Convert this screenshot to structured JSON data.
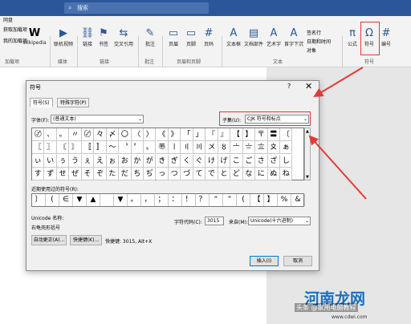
{
  "titlebar": {
    "search_placeholder": "搜索",
    "search_icon": "search-icon",
    "left_text": "网盘"
  },
  "ribbon": {
    "items": [
      {
        "label": "Wikipedia",
        "glyph": "W"
      },
      {
        "label": "联机视频",
        "glyph": "▶"
      },
      {
        "label": "链接",
        "glyph": "⛓"
      },
      {
        "label": "书签",
        "glyph": "⚑"
      },
      {
        "label": "交叉引用",
        "glyph": "⇆"
      },
      {
        "label": "批注",
        "glyph": "✎"
      },
      {
        "label": "页眉",
        "glyph": "▭"
      },
      {
        "label": "页脚",
        "glyph": "▭"
      },
      {
        "label": "页码",
        "glyph": "#"
      },
      {
        "label": "文本框",
        "glyph": "A"
      },
      {
        "label": "文档部件",
        "glyph": "▤"
      },
      {
        "label": "艺术字",
        "glyph": "A"
      },
      {
        "label": "首字下沉",
        "glyph": "A"
      },
      {
        "label": "公式",
        "glyph": "π"
      },
      {
        "label": "符号",
        "glyph": "Ω"
      },
      {
        "label": "编号",
        "glyph": "#"
      }
    ],
    "small_items": [
      "签名行",
      "日期和时间",
      "对象"
    ],
    "left_items": [
      "加载项",
      "获取加载项",
      "我的加载项"
    ],
    "groups": [
      "加载项",
      "媒体",
      "链接",
      "批注",
      "页眉和页脚",
      "文本",
      "符号"
    ]
  },
  "dialog": {
    "title": "符号",
    "help": "?",
    "close": "✕",
    "tabs": [
      "符号(S)",
      "特殊字符(P)"
    ],
    "font_label": "字体(F):",
    "font_value": "(普通文本)",
    "subset_label": "子集(U):",
    "subset_value": "CJK 符号和标点",
    "symbols": [
      [
        "〄",
        "、",
        "。",
        "〃",
        "〄",
        "々",
        "〆",
        "〇",
        "〈",
        "〉",
        "《",
        "》",
        "「",
        "」",
        "『",
        "』",
        "【",
        "】",
        "〒",
        "〓",
        "〔",
        "〕"
      ],
      [
        "〖",
        "〗",
        "〘",
        "〙",
        "〚",
        "〛",
        "〜",
        "〝",
        "〞",
        "〟",
        "〠",
        "〡",
        "〢",
        "〣",
        "〤",
        "〥",
        "〦",
        "〧",
        "〨",
        "〩",
        "ぁ",
        "あ"
      ],
      [
        "ぃ",
        "い",
        "ぅ",
        "う",
        "ぇ",
        "え",
        "ぉ",
        "お",
        "か",
        "が",
        "き",
        "ぎ",
        "く",
        "ぐ",
        "け",
        "げ",
        "こ",
        "ご",
        "さ",
        "ざ",
        "し",
        "じ"
      ],
      [
        "す",
        "ず",
        "せ",
        "ぜ",
        "そ",
        "ぞ",
        "た",
        "だ",
        "ち",
        "ぢ",
        "っ",
        "つ",
        "づ",
        "て",
        "で",
        "と",
        "ど",
        "な",
        "に",
        "ぬ",
        "ね",
        "の"
      ]
    ],
    "selected_index": [
      0,
      21
    ],
    "recent_label": "近期使用过的符号(R):",
    "recent": [
      "〕",
      "(",
      "∈",
      "▼",
      "▲",
      "",
      "▼",
      "。",
      "，",
      "；",
      "：",
      "！",
      "？",
      "“",
      "”",
      "(",
      "【",
      "】",
      "%",
      "&"
    ],
    "unicode_name_label": "Unicode 名称:",
    "unicode_name": "右龟壳形括号",
    "charcode_label": "字符代码(C):",
    "charcode_value": "3015",
    "from_label": "来自(M):",
    "from_value": "Unicode(十六进制)",
    "autocorrect_btn": "自动更正(A)...",
    "shortcut_btn": "快捷键(K)...",
    "shortcut_text": "快捷键: 3015, Alt+X",
    "insert_btn": "插入(I)",
    "cancel_btn": "取消"
  },
  "watermark": {
    "title": "河南龙网",
    "sub": "www.cdwi.com",
    "small": "头条 @家用电脑教程"
  },
  "colors": {
    "accent": "#2b579a",
    "highlight": "#e53935",
    "selected": "#1a73e8"
  }
}
